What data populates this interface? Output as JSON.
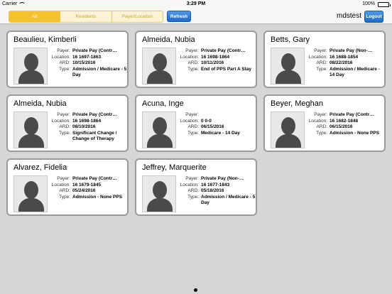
{
  "status_bar": {
    "carrier": "Carrier",
    "time": "3:29 PM",
    "battery": "100%"
  },
  "toolbar": {
    "segments": [
      "All",
      "Residents",
      "Payer/Location"
    ],
    "active_segment": 0,
    "refresh_label": "Refresh",
    "username": "mdstest",
    "logout_label": "Logout"
  },
  "labels": {
    "payer": "Payer:",
    "location": "Location:",
    "ard": "ARD:",
    "type": "Type:"
  },
  "residents": [
    {
      "name": "Beaulieu, Kimberli",
      "payer": "Private Pay (Contr…",
      "location": "16 1697-1863",
      "ard": "10/15/2016",
      "type": "Admission / Medicare - 5 Day"
    },
    {
      "name": "Almeida, Nubia",
      "payer": "Private Pay (Contr…",
      "location": "16 1698-1864",
      "ard": "10/11/2016",
      "type": "End of PPS Part A Stay"
    },
    {
      "name": "Betts, Gary",
      "payer": "Private Pay (Non-…",
      "location": "16 1688-1854",
      "ard": "08/22/2016",
      "type": "Admission / Medicare - 14 Day"
    },
    {
      "name": "Almeida, Nubia",
      "payer": "Private Pay (Contr…",
      "location": "16 1698-1864",
      "ard": "08/10/2016",
      "type": "Significant Change / Change of Therapy"
    },
    {
      "name": "Acuna, Inge",
      "payer": "",
      "location": "0 0-0",
      "ard": "06/15/2016",
      "type": "Medicare - 14 Day"
    },
    {
      "name": "Beyer, Meghan",
      "payer": "Private Pay (Contr…",
      "location": "16 1682-1848",
      "ard": "06/15/2016",
      "type": "Admission - None PPS"
    },
    {
      "name": "Alvarez, Fidelia",
      "payer": "Private Pay (Contr…",
      "location": "16 1679-1845",
      "ard": "05/24/2016",
      "type": "Admission - None PPS"
    },
    {
      "name": "Jeffrey, Marquerite",
      "payer": "Private Pay (Non-…",
      "location": "16 1677-1843",
      "ard": "05/18/2016",
      "type": "Admission / Medicare - 5 Day"
    }
  ]
}
